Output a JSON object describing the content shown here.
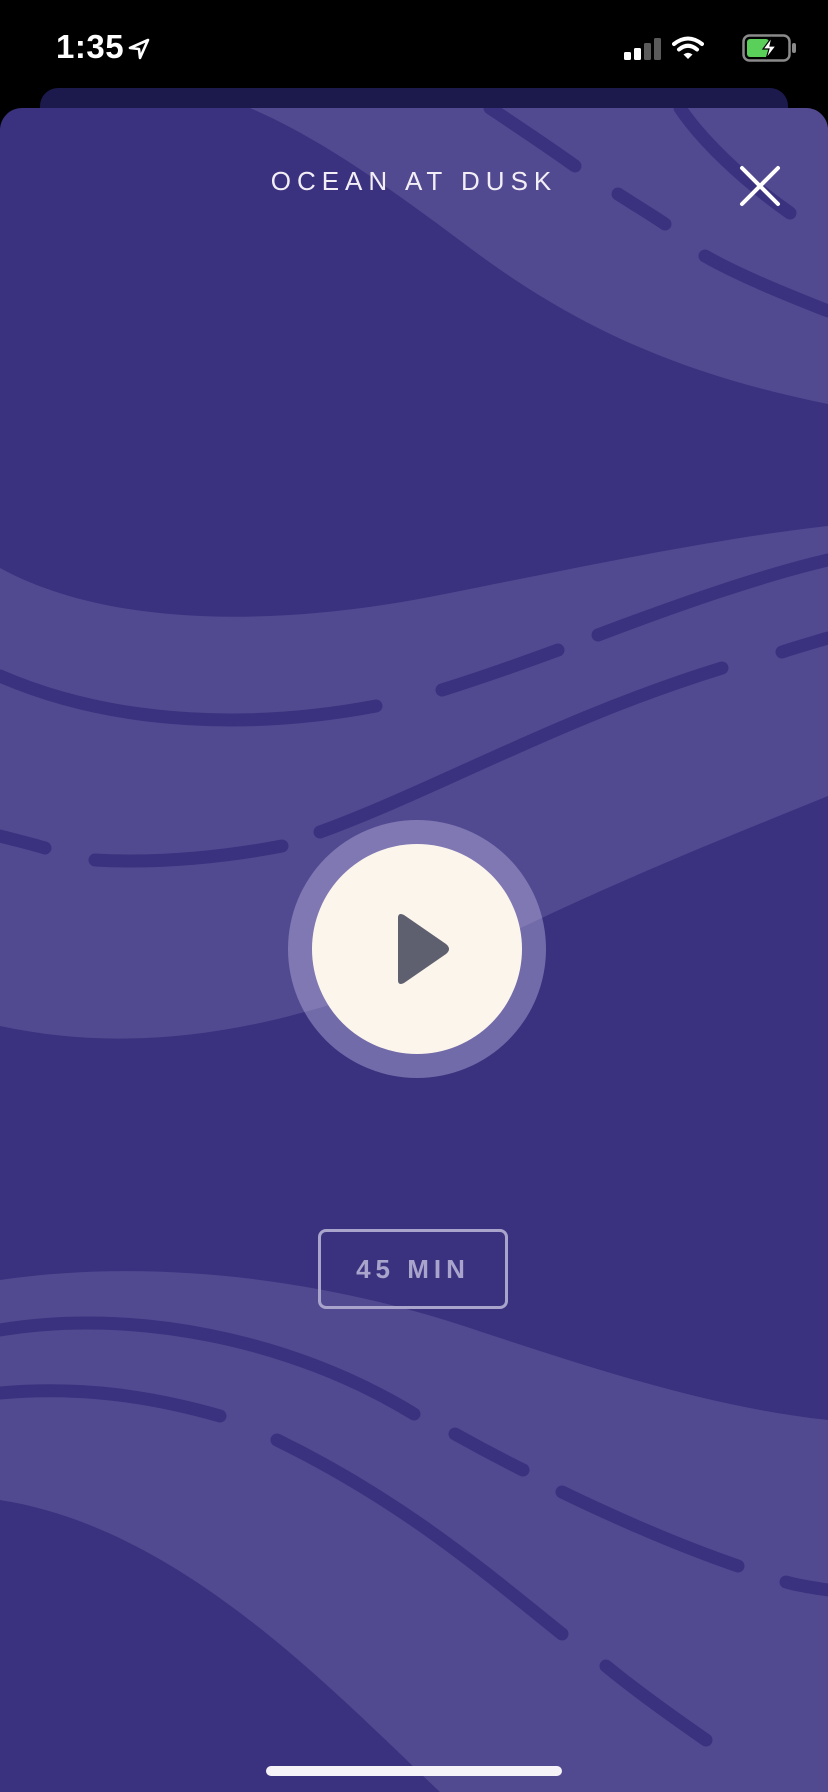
{
  "status_bar": {
    "time": "1:35",
    "icons": [
      "location-arrow-icon",
      "cellular-signal-icon",
      "wifi-icon",
      "battery-charging-icon"
    ]
  },
  "player": {
    "title": "OCEAN AT DUSK",
    "close_icon": "close-icon",
    "play_icon": "play-icon",
    "duration_label": "45 MIN"
  },
  "colors": {
    "background": "#3a327e",
    "wave_light": "#524a90",
    "wave_line": "#3a327e",
    "play_button": "#fcf5ec",
    "play_glyph": "#5e6070",
    "duration_text": "#a9a4cc",
    "battery_fill": "#5ad05a"
  }
}
